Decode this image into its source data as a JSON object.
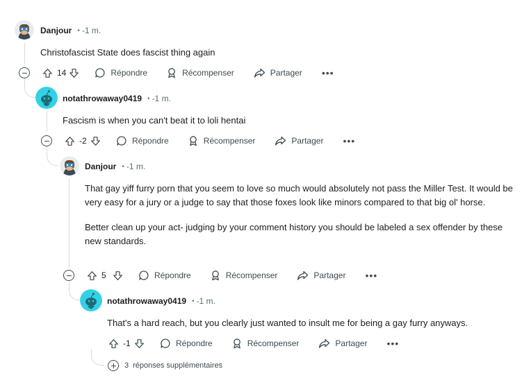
{
  "comments": [
    {
      "author": "Danjour",
      "time": "-1 m.",
      "body": [
        "Christofascist State does fascist thing again"
      ],
      "score": "14",
      "avatar": "danjour-avatar"
    },
    {
      "author": "notathrowaway0419",
      "time": "-1 m.",
      "body": [
        "Fascism is when you can't beat it to loli hentai"
      ],
      "score": "-2",
      "avatar": "snoo-avatar"
    },
    {
      "author": "Danjour",
      "time": "-1 m.",
      "body": [
        "That gay yiff furry porn that you seem to love so much would absolutely not pass the Miller Test. It would be very easy for a jury or a judge to say that those foxes look like minors compared to that big ol' horse.",
        "Better clean up your act- judging by your comment history you should be labeled a sex offender by these new standards."
      ],
      "score": "5",
      "avatar": "danjour-avatar"
    },
    {
      "author": "notathrowaway0419",
      "time": "-1 m.",
      "body": [
        "That's a hard reach, but you clearly just wanted to insult me for being a gay furry anyways."
      ],
      "score": "-1",
      "avatar": "snoo-avatar"
    }
  ],
  "actions": {
    "reply": "Répondre",
    "award": "Récompenser",
    "share": "Partager",
    "more": "•••"
  },
  "more_replies": {
    "count": "3",
    "label": "réponses supplémentaires"
  },
  "colors": {
    "snoo_bg": "#33d1e5",
    "thread_line": "#d7dadc",
    "icon": "#3c4a50"
  }
}
